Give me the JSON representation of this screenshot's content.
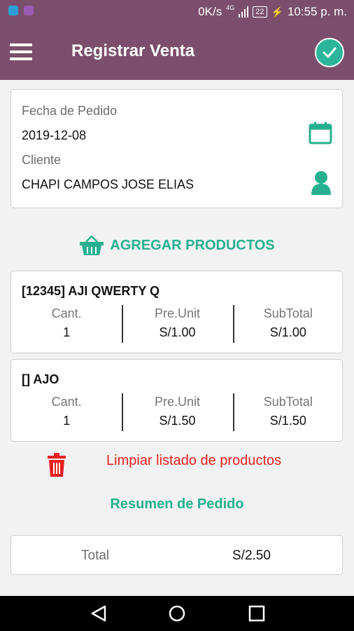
{
  "status_bar": {
    "network_speed": "0K/s",
    "network_type": "4G",
    "battery": "22",
    "time": "10:55 p. m."
  },
  "app_bar": {
    "title": "Registrar Venta"
  },
  "order": {
    "date_label": "Fecha de Pedido",
    "date_value": "2019-12-08",
    "client_label": "Cliente",
    "client_value": "CHAPI CAMPOS JOSE ELIAS"
  },
  "add_products_label": "AGREGAR PRODUCTOS",
  "products": [
    {
      "title": "[12345] AJI QWERTY Q",
      "qty_label": "Cant.",
      "qty": "1",
      "price_label": "Pre.Unit",
      "price": "S/1.00",
      "subtotal_label": "SubTotal",
      "subtotal": "S/1.00"
    },
    {
      "title": "[] AJO",
      "qty_label": "Cant.",
      "qty": "1",
      "price_label": "Pre.Unit",
      "price": "S/1.50",
      "subtotal_label": "SubTotal",
      "subtotal": "S/1.50"
    }
  ],
  "clear_label": "Limpiar listado de productos",
  "summary_title": "Resumen de Pedido",
  "summary": {
    "total_label": "Total",
    "total_value": "S/2.50"
  },
  "colors": {
    "app_bar": "#7b4f6c",
    "accent": "#26b08f",
    "danger": "#e52020"
  },
  "icons": [
    "menu-icon",
    "check-icon",
    "calendar-icon",
    "person-icon",
    "basket-icon",
    "trash-icon",
    "back-icon",
    "home-icon",
    "recents-icon"
  ]
}
